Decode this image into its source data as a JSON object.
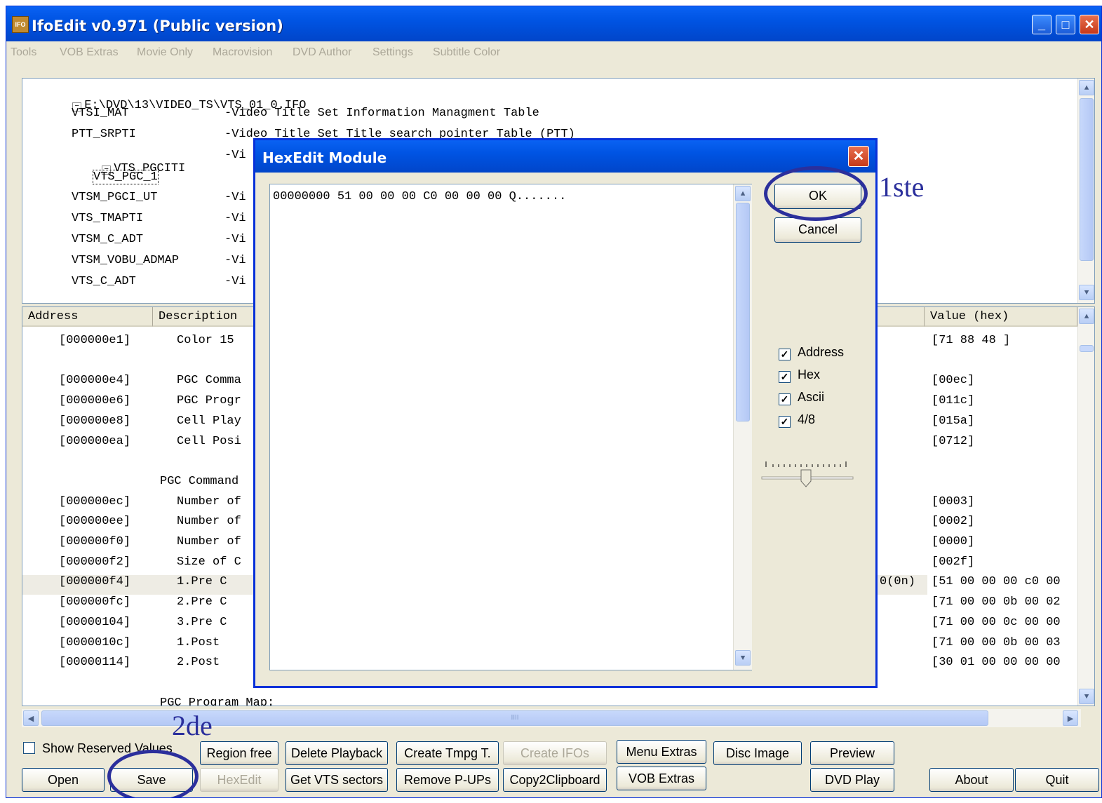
{
  "window": {
    "title": "IfoEdit v0.971 (Public version)",
    "icon_label": "IFO"
  },
  "menu": [
    "Tools",
    "VOB Extras",
    "Movie Only",
    "Macrovision",
    "DVD Author",
    "Settings",
    "Subtitle Color"
  ],
  "tree": {
    "root": "E:\\DVD\\13\\VIDEO_TS\\VTS_01_0.IFO",
    "items": [
      {
        "name": "VTSI_MAT",
        "desc": "-Video Title Set Information Managment Table"
      },
      {
        "name": "PTT_SRPTI",
        "desc": "-Video Title Set Title search pointer Table (PTT)"
      },
      {
        "name": "VTS_PGCITI",
        "desc": "-Vi"
      },
      {
        "name": "VTS_PGC_1",
        "desc": ""
      },
      {
        "name": "VTSM_PGCI_UT",
        "desc": "-Vi"
      },
      {
        "name": "VTS_TMAPTI",
        "desc": "-Vi"
      },
      {
        "name": "VTSM_C_ADT",
        "desc": "-Vi"
      },
      {
        "name": "VTSM_VOBU_ADMAP",
        "desc": "-Vi"
      },
      {
        "name": "VTS_C_ADT",
        "desc": "-Vi"
      }
    ]
  },
  "list": {
    "headers": {
      "address": "Address",
      "description": "Description",
      "value": "Value (hex)"
    },
    "rows": [
      {
        "addr": "[000000e1]",
        "desc": "Color 15",
        "extra": "",
        "val": "[71 88 48 ]"
      },
      {
        "addr": "",
        "desc": "",
        "extra": "",
        "val": ""
      },
      {
        "addr": "[000000e4]",
        "desc": "PGC Comma",
        "extra": "",
        "val": "[00ec]"
      },
      {
        "addr": "[000000e6]",
        "desc": "PGC Progr",
        "extra": "",
        "val": "[011c]"
      },
      {
        "addr": "[000000e8]",
        "desc": "Cell Play",
        "extra": "",
        "val": "[015a]"
      },
      {
        "addr": "[000000ea]",
        "desc": "Cell Posi",
        "extra": "",
        "val": "[0712]"
      },
      {
        "addr": "",
        "desc": "",
        "extra": "",
        "val": ""
      },
      {
        "addr": "",
        "desc": "PGC Command",
        "extra": "",
        "val": ""
      },
      {
        "addr": "[000000ec]",
        "desc": "Number of",
        "extra": "",
        "val": "[0003]"
      },
      {
        "addr": "[000000ee]",
        "desc": "Number of",
        "extra": "",
        "val": "[0002]"
      },
      {
        "addr": "[000000f0]",
        "desc": "Number of",
        "extra": "",
        "val": "[0000]"
      },
      {
        "addr": "[000000f2]",
        "desc": "Size of C",
        "extra": "",
        "val": "[002f]"
      },
      {
        "addr": "[000000f4]",
        "desc": "1.Pre C",
        "extra": "0(0n)",
        "val": "[51 00 00 00 c0 00"
      },
      {
        "addr": "[000000fc]",
        "desc": "2.Pre C",
        "extra": "",
        "val": "[71 00 00 0b 00 02"
      },
      {
        "addr": "[00000104]",
        "desc": "3.Pre C",
        "extra": "",
        "val": "[71 00 00 0c 00 00"
      },
      {
        "addr": "[0000010c]",
        "desc": "1.Post",
        "extra": "",
        "val": "[71 00 00 0b 00 03"
      },
      {
        "addr": "[00000114]",
        "desc": "2.Post",
        "extra": "",
        "val": "[30 01 00 00 00 00"
      },
      {
        "addr": "",
        "desc": "",
        "extra": "",
        "val": ""
      },
      {
        "addr": "",
        "desc": "PGC Program Map:",
        "extra": "",
        "val": ""
      }
    ]
  },
  "dialog": {
    "title": "HexEdit Module",
    "hex_line": "00000000 51 00 00 00 C0 00 00 00 Q.......",
    "ok": "OK",
    "cancel": "Cancel",
    "checkboxes": [
      {
        "label": "Address",
        "checked": true
      },
      {
        "label": "Hex",
        "checked": true
      },
      {
        "label": "Ascii",
        "checked": true
      },
      {
        "label": "4/8",
        "checked": true
      }
    ]
  },
  "bottom": {
    "show_reserved": "Show Reserved Values",
    "open": "Open",
    "save": "Save",
    "region_free": "Region free",
    "hexedit": "HexEdit",
    "delete_playback": "Delete Playback",
    "get_vts_sectors": "Get VTS sectors",
    "create_tmpg": "Create Tmpg T.",
    "remove_pups": "Remove P-UPs",
    "create_ifos": "Create IFOs",
    "copy2clipboard": "Copy2Clipboard",
    "menu_extras": "Menu Extras",
    "vob_extras": "VOB Extras",
    "disc_image": "Disc Image",
    "preview": "Preview",
    "dvd_play": "DVD Play",
    "about": "About",
    "quit": "Quit"
  },
  "scroll": {
    "hscroll_grip": "IIII"
  },
  "annotations": {
    "first": "1ste",
    "second": "2de"
  },
  "colors": {
    "annotation": "#2b2f9c",
    "titlebar": "#0054e3"
  }
}
